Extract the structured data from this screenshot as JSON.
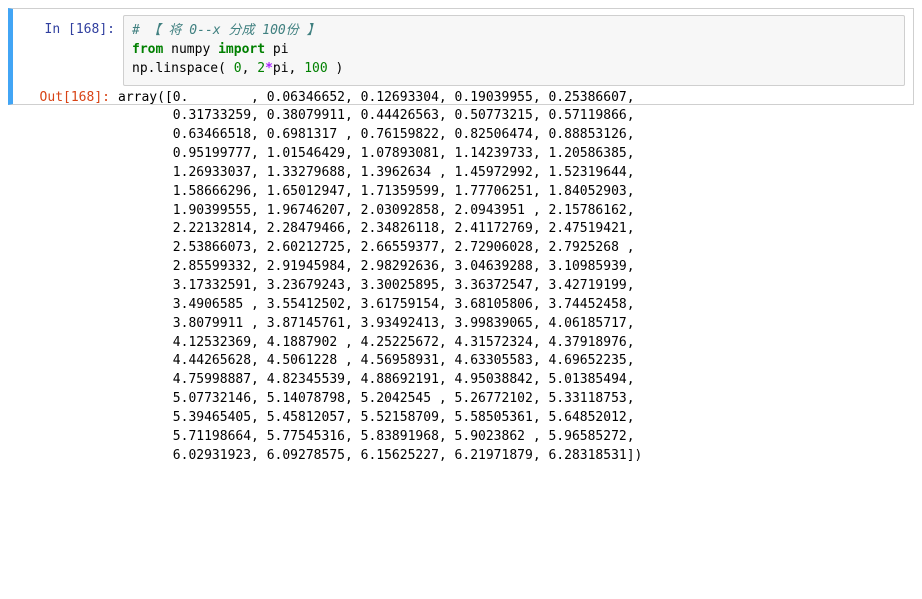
{
  "input_prompt": "In  [168]:",
  "output_prompt": "Out[168]:",
  "code": {
    "comment": "# 【 将 0--x 分成 100份 】",
    "l2_from": "from",
    "l2_numpy": " numpy ",
    "l2_import": "import",
    "l2_pi": " pi",
    "l3_pre": "np.linspace( ",
    "l3_zero": "0",
    "l3_comma": ", ",
    "l3_two": "2",
    "l3_star": "*",
    "l3_pi": "pi, ",
    "l3_hundred": "100",
    "l3_end": " )"
  },
  "output": "array([0.        , 0.06346652, 0.12693304, 0.19039955, 0.25386607,\n       0.31733259, 0.38079911, 0.44426563, 0.50773215, 0.57119866,\n       0.63466518, 0.6981317 , 0.76159822, 0.82506474, 0.88853126,\n       0.95199777, 1.01546429, 1.07893081, 1.14239733, 1.20586385,\n       1.26933037, 1.33279688, 1.3962634 , 1.45972992, 1.52319644,\n       1.58666296, 1.65012947, 1.71359599, 1.77706251, 1.84052903,\n       1.90399555, 1.96746207, 2.03092858, 2.0943951 , 2.15786162,\n       2.22132814, 2.28479466, 2.34826118, 2.41172769, 2.47519421,\n       2.53866073, 2.60212725, 2.66559377, 2.72906028, 2.7925268 ,\n       2.85599332, 2.91945984, 2.98292636, 3.04639288, 3.10985939,\n       3.17332591, 3.23679243, 3.30025895, 3.36372547, 3.42719199,\n       3.4906585 , 3.55412502, 3.61759154, 3.68105806, 3.74452458,\n       3.8079911 , 3.87145761, 3.93492413, 3.99839065, 4.06185717,\n       4.12532369, 4.1887902 , 4.25225672, 4.31572324, 4.37918976,\n       4.44265628, 4.5061228 , 4.56958931, 4.63305583, 4.69652235,\n       4.75998887, 4.82345539, 4.88692191, 4.95038842, 5.01385494,\n       5.07732146, 5.14078798, 5.2042545 , 5.26772102, 5.33118753,\n       5.39465405, 5.45812057, 5.52158709, 5.58505361, 5.64852012,\n       5.71198664, 5.77545316, 5.83891968, 5.9023862 , 5.96585272,\n       6.02931923, 6.09278575, 6.15625227, 6.21971879, 6.28318531])"
}
